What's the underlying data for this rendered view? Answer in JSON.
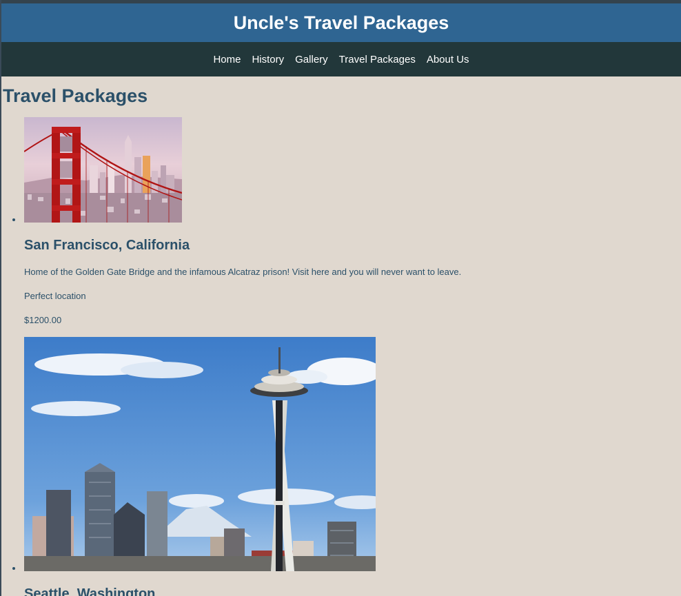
{
  "site": {
    "title": "Uncle's Travel Packages"
  },
  "nav": {
    "items": [
      {
        "label": "Home"
      },
      {
        "label": "History"
      },
      {
        "label": "Gallery"
      },
      {
        "label": "Travel Packages"
      },
      {
        "label": "About Us"
      }
    ]
  },
  "main": {
    "heading": "Travel Packages",
    "packages": [
      {
        "image_subject": "Golden Gate Bridge and San Francisco skyline",
        "title": "San Francisco, California",
        "description": "Home of the Golden Gate Bridge and the infamous Alcatraz prison! Visit here and you will never want to leave.",
        "tagline": "Perfect location",
        "price": "$1200.00"
      },
      {
        "image_subject": "Seattle Space Needle and skyline",
        "title": "Seattle, Washington"
      }
    ]
  },
  "colors": {
    "header_bg": "#2f6592",
    "nav_bg": "#22373a",
    "page_bg": "#e0d8cf",
    "text": "#2b5069"
  }
}
